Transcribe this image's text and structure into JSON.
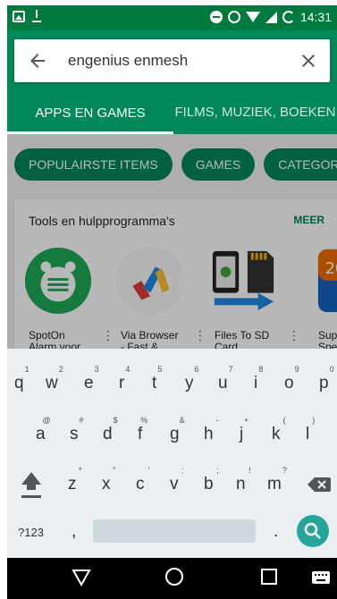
{
  "status_bar": {
    "time": "14:31"
  },
  "search": {
    "query": "engenius enmesh"
  },
  "tabs": [
    {
      "label": "APPS EN GAMES",
      "active": true
    },
    {
      "label": "FILMS, MUZIEK, BOEKEN",
      "active": false
    }
  ],
  "chips": [
    "POPULAIRSTE ITEMS",
    "GAMES",
    "CATEGOR"
  ],
  "section": {
    "title": "Tools en hulpprogramma's",
    "more": "MEER",
    "apps": [
      {
        "name_line1": "SpotOn",
        "name_line2": "Alarm voor",
        "icon": "spoton-alarm-icon"
      },
      {
        "name_line1": "Via Browser",
        "name_line2": "- Fast &",
        "icon": "via-browser-icon"
      },
      {
        "name_line1": "Files To SD",
        "name_line2": "Card",
        "icon": "files-to-sd-icon"
      },
      {
        "name_line1": "Supe",
        "name_line2": "Spee",
        "icon": "calendar-2019-icon"
      }
    ]
  },
  "keyboard": {
    "row1": [
      {
        "k": "q",
        "h": "1"
      },
      {
        "k": "w",
        "h": "2"
      },
      {
        "k": "e",
        "h": "3"
      },
      {
        "k": "r",
        "h": "4"
      },
      {
        "k": "t",
        "h": "5"
      },
      {
        "k": "y",
        "h": "6"
      },
      {
        "k": "u",
        "h": "7"
      },
      {
        "k": "i",
        "h": "8"
      },
      {
        "k": "o",
        "h": "9"
      },
      {
        "k": "p",
        "h": "0"
      }
    ],
    "row2": [
      {
        "k": "a",
        "h": "@"
      },
      {
        "k": "s",
        "h": "#"
      },
      {
        "k": "d",
        "h": "$"
      },
      {
        "k": "f",
        "h": "%"
      },
      {
        "k": "g",
        "h": "&"
      },
      {
        "k": "h",
        "h": "-"
      },
      {
        "k": "j",
        "h": "+"
      },
      {
        "k": "k",
        "h": "("
      },
      {
        "k": "l",
        "h": ")"
      }
    ],
    "row3": [
      {
        "k": "z",
        "h": "*"
      },
      {
        "k": "x",
        "h": "\""
      },
      {
        "k": "c",
        "h": "'"
      },
      {
        "k": "v",
        "h": ":"
      },
      {
        "k": "b",
        "h": ";"
      },
      {
        "k": "n",
        "h": "!"
      },
      {
        "k": "m",
        "h": "?"
      }
    ],
    "symbols_label": "?123",
    "comma": ",",
    "period": "."
  },
  "colors": {
    "brand_green": "#00875a",
    "status_green": "#007a3d",
    "go_button": "#26a69a"
  }
}
